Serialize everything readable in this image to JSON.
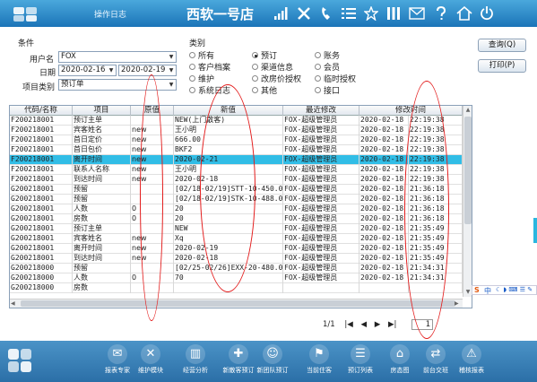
{
  "header": {
    "app_title": "操作日志",
    "hotel": "西软一号店"
  },
  "top_icons": [
    "signal-icon",
    "tools-icon",
    "phone-icon",
    "list-icon",
    "star-icon",
    "columns-icon",
    "mail-icon",
    "help-icon",
    "home-icon",
    "power-icon"
  ],
  "filters": {
    "group_label": "条件",
    "user_label": "用户名",
    "user_value": "FOX",
    "date_label": "日期",
    "date_from": "2020-02-16",
    "date_to": "2020-02-19",
    "type_label": "项目类别",
    "type_value": "预订单"
  },
  "category": {
    "label": "类别",
    "options": [
      "所有",
      "预订",
      "账务",
      "客户档案",
      "渠道信息",
      "会员",
      "维护",
      "改房价授权",
      "临时授权",
      "系统日志",
      "其他",
      "接口"
    ],
    "selected": "预订"
  },
  "buttons": {
    "query": "查询(Q)",
    "print": "打印(P)"
  },
  "table": {
    "columns": [
      "代码/名称",
      "项目",
      "原值",
      "新值",
      "最近修改",
      "修改时间"
    ],
    "rows": [
      [
        "F200218001",
        "预订主单",
        "",
        "NEW(上门散客)",
        "FOX-超级管理员",
        "2020-02-18",
        "22:19:38"
      ],
      [
        "F200218001",
        "宾客姓名",
        "new",
        "王小明",
        "FOX-超级管理员",
        "2020-02-18",
        "22:19:38"
      ],
      [
        "F200218001",
        "首日定价",
        "new",
        "666.00",
        "FOX-超级管理员",
        "2020-02-18",
        "22:19:38"
      ],
      [
        "F200218001",
        "首日包价",
        "new",
        "BKF2",
        "FOX-超级管理员",
        "2020-02-18",
        "22:19:38"
      ],
      [
        "F200218001",
        "离开时间",
        "new",
        "2020-02-21",
        "FOX-超级管理员",
        "2020-02-18",
        "22:19:38"
      ],
      [
        "F200218001",
        "联系人名称",
        "new",
        "王小明",
        "FOX-超级管理员",
        "2020-02-18",
        "22:19:38"
      ],
      [
        "F200218001",
        "到达时间",
        "new",
        "2020-02-18",
        "FOX-超级管理员",
        "2020-02-18",
        "22:19:38"
      ],
      [
        "G200218001",
        "预留",
        "",
        "[02/18-02/19]STT-10-450.0",
        "FOX-超级管理员",
        "2020-02-18",
        "21:36:18"
      ],
      [
        "G200218001",
        "预留",
        "",
        "[02/18-02/19]STK-10-488.0",
        "FOX-超级管理员",
        "2020-02-18",
        "21:36:18"
      ],
      [
        "G200218001",
        "人数",
        "0",
        "20",
        "FOX-超级管理员",
        "2020-02-18",
        "21:36:18"
      ],
      [
        "G200218001",
        "房数",
        "0",
        "20",
        "FOX-超级管理员",
        "2020-02-18",
        "21:36:18"
      ],
      [
        "G200218001",
        "预订主单",
        "",
        "NEW",
        "FOX-超级管理员",
        "2020-02-18",
        "21:35:49"
      ],
      [
        "G200218001",
        "宾客姓名",
        "new",
        "Xq",
        "FOX-超级管理员",
        "2020-02-18",
        "21:35:49"
      ],
      [
        "G200218001",
        "离开时间",
        "new",
        "2020-02-19",
        "FOX-超级管理员",
        "2020-02-18",
        "21:35:49"
      ],
      [
        "G200218001",
        "到达时间",
        "new",
        "2020-02-18",
        "FOX-超级管理员",
        "2020-02-18",
        "21:35:49"
      ],
      [
        "G200218000",
        "预留",
        "",
        "[02/25-02/26]EXX-20-480.0",
        "FOX-超级管理员",
        "2020-02-18",
        "21:34:31"
      ],
      [
        "G200218000",
        "人数",
        "0",
        "70",
        "FOX-超级管理员",
        "2020-02-18",
        "21:34:31"
      ],
      [
        "G200218000",
        "房数",
        "",
        "",
        "",
        "",
        ""
      ]
    ],
    "selected_row": 4
  },
  "pager": {
    "page": "1/1",
    "num": "1"
  },
  "bottom_nav": [
    {
      "label": "报表专家",
      "icon": "report-expert-icon"
    },
    {
      "label": "维护模块",
      "icon": "maintenance-icon"
    },
    {
      "label": "经营分析",
      "icon": "analysis-chart-icon"
    },
    {
      "label": "新散客预订",
      "icon": "new-guest-booking-icon"
    },
    {
      "label": "新团队预订",
      "icon": "new-group-booking-icon"
    },
    {
      "label": "当前住客",
      "icon": "current-guests-icon"
    },
    {
      "label": "预订列表",
      "icon": "booking-list-icon"
    },
    {
      "label": "房态图",
      "icon": "room-status-icon"
    },
    {
      "label": "前台交班",
      "icon": "shift-handover-icon"
    },
    {
      "label": "稽核报表",
      "icon": "audit-report-icon"
    }
  ],
  "ime": {
    "label": "中"
  }
}
